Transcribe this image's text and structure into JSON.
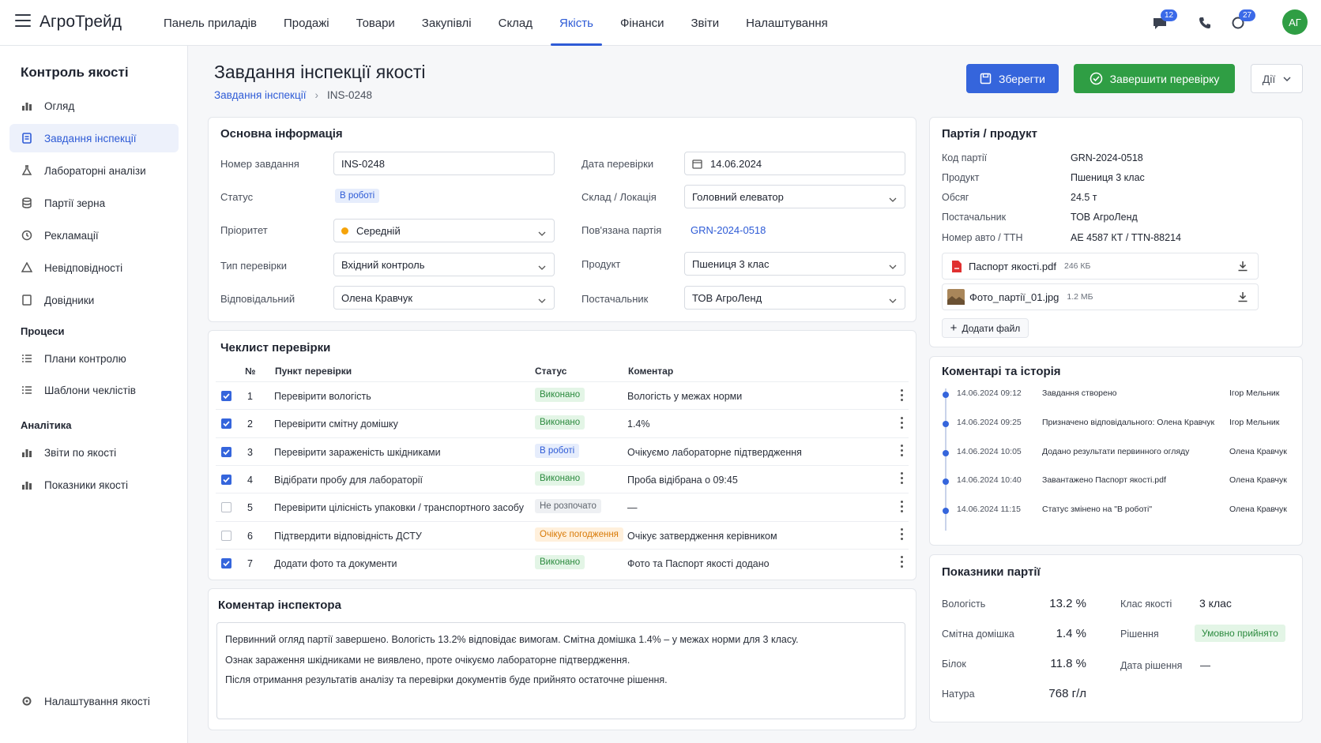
{
  "app": {
    "title": "АгроТрейд"
  },
  "nav": [
    "Панель приладів",
    "Продажі",
    "Товари",
    "Закупівлі",
    "Склад",
    "Якість",
    "Фінанси",
    "Звіти",
    "Налаштування"
  ],
  "notifications": {
    "messages_count": "12",
    "alerts_count": "27"
  },
  "user": {
    "initials": "АГ"
  },
  "sidebar": {
    "title": "Контроль якості",
    "items": [
      "Огляд",
      "Завдання інспекції",
      "Лабораторні аналізи",
      "Партії зерна",
      "Рекламації",
      "Невідповідності",
      "Довідники"
    ],
    "section_processes": "Процеси",
    "process_items": [
      "Плани контролю",
      "Шаблони чеклістів"
    ],
    "section_analytics": "Аналітика",
    "analytics_items": [
      "Звіти по якості",
      "Показники якості"
    ],
    "settings": "Налаштування якості"
  },
  "page": {
    "title": "Завдання інспекції якості",
    "breadcrumb_parent": "Завдання інспекції",
    "breadcrumb_current": "INS-0248",
    "save_label": "Зберегти",
    "complete_label": "Завершити перевірку",
    "actions_label": "Дії"
  },
  "basic": {
    "title": "Основна інформація",
    "task_number_label": "Номер завдання",
    "task_number": "INS-0248",
    "status_label": "Статус",
    "status": "В роботі",
    "priority_label": "Пріоритет",
    "priority": "Середній",
    "check_type_label": "Тип перевірки",
    "check_type": "Вхідний контроль",
    "responsible_label": "Відповідальний",
    "responsible": "Олена Кравчук",
    "date_label": "Дата перевірки",
    "date": "14.06.2024",
    "location_label": "Склад / Локація",
    "location": "Головний елеватор",
    "batch_label": "Пов'язана партія",
    "batch": "GRN-2024-0518",
    "product_label": "Продукт",
    "product": "Пшениця 3 клас",
    "supplier_label": "Постачальник",
    "supplier": "ТОВ АгроЛенд"
  },
  "checklist": {
    "title": "Чеклист перевірки",
    "headers": {
      "num": "№",
      "item": "Пункт перевірки",
      "status": "Статус",
      "comment": "Коментар"
    },
    "rows": [
      {
        "checked": true,
        "num": "1",
        "item": "Перевірити вологість",
        "status": "Виконано",
        "status_kind": "green",
        "comment": "Вологість у межах норми"
      },
      {
        "checked": true,
        "num": "2",
        "item": "Перевірити смітну домішку",
        "status": "Виконано",
        "status_kind": "green",
        "comment": "1.4%"
      },
      {
        "checked": true,
        "num": "3",
        "item": "Перевірити зараженість шкідниками",
        "status": "В роботі",
        "status_kind": "blue",
        "comment": "Очікуємо лабораторне підтвердження"
      },
      {
        "checked": true,
        "num": "4",
        "item": "Відібрати пробу для лабораторії",
        "status": "Виконано",
        "status_kind": "green",
        "comment": "Проба відібрана о 09:45"
      },
      {
        "checked": false,
        "num": "5",
        "item": "Перевірити цілісність упаковки / транспортного засобу",
        "status": "Не розпочато",
        "status_kind": "gray",
        "comment": "—"
      },
      {
        "checked": false,
        "num": "6",
        "item": "Підтвердити відповідність ДСТУ",
        "status": "Очікує погодження",
        "status_kind": "orange",
        "comment": "Очікує затвердження керівником"
      },
      {
        "checked": true,
        "num": "7",
        "item": "Додати фото та документи",
        "status": "Виконано",
        "status_kind": "green",
        "comment": "Фото та Паспорт якості додано"
      }
    ]
  },
  "inspector": {
    "title": "Коментар інспектора",
    "lines": [
      "Первинний огляд партії завершено. Вологість 13.2% відповідає вимогам. Смітна домішка 1.4% – у межах норми для 3 класу.",
      "Ознак зараження шкідниками не виявлено, проте очікуємо лабораторне підтвердження.",
      "Після отримання результатів аналізу та перевірки документів буде прийнято остаточне рішення."
    ]
  },
  "batch": {
    "title": "Партія / продукт",
    "fields": [
      {
        "label": "Код партії",
        "value": "GRN-2024-0518"
      },
      {
        "label": "Продукт",
        "value": "Пшениця 3 клас"
      },
      {
        "label": "Обсяг",
        "value": "24.5 т"
      },
      {
        "label": "Постачальник",
        "value": "ТОВ АгроЛенд"
      },
      {
        "label": "Номер авто / ТТН",
        "value": "АЕ 4587 КТ / TTN-88214"
      }
    ],
    "files": [
      {
        "name": "Паспорт якості.pdf",
        "size": "246 КБ"
      },
      {
        "name": "Фото_партії_01.jpg",
        "size": "1.2 МБ"
      }
    ],
    "add_file": "Додати файл"
  },
  "history": {
    "title": "Коментарі та історія",
    "events": [
      {
        "time": "14.06.2024  09:12",
        "text": "Завдання створено",
        "user": "Ігор Мельник"
      },
      {
        "time": "14.06.2024  09:25",
        "text": "Призначено відповідального: Олена Кравчук",
        "user": "Ігор Мельник"
      },
      {
        "time": "14.06.2024  10:05",
        "text": "Додано результати первинного огляду",
        "user": "Олена Кравчук"
      },
      {
        "time": "14.06.2024  10:40",
        "text": "Завантажено Паспорт якості.pdf",
        "user": "Олена Кравчук"
      },
      {
        "time": "14.06.2024  11:15",
        "text": "Статус змінено на \"В роботі\"",
        "user": "Олена Кравчук"
      }
    ]
  },
  "metrics": {
    "title": "Показники партії",
    "left": [
      {
        "label": "Вологість",
        "value": "13.2 %"
      },
      {
        "label": "Смітна домішка",
        "value": "1.4 %"
      },
      {
        "label": "Білок",
        "value": "11.8 %"
      },
      {
        "label": "Натура",
        "value": "768 г/л"
      }
    ],
    "class_label": "Клас якості",
    "class_value": "3 клас",
    "decision_label": "Рішення",
    "decision_value": "Умовно прийнято",
    "decision_date_label": "Дата рішення",
    "decision_date_value": "—"
  },
  "colors": {
    "accent": "#3565dc",
    "success": "#2f9e44",
    "warning": "#f5a30a"
  }
}
